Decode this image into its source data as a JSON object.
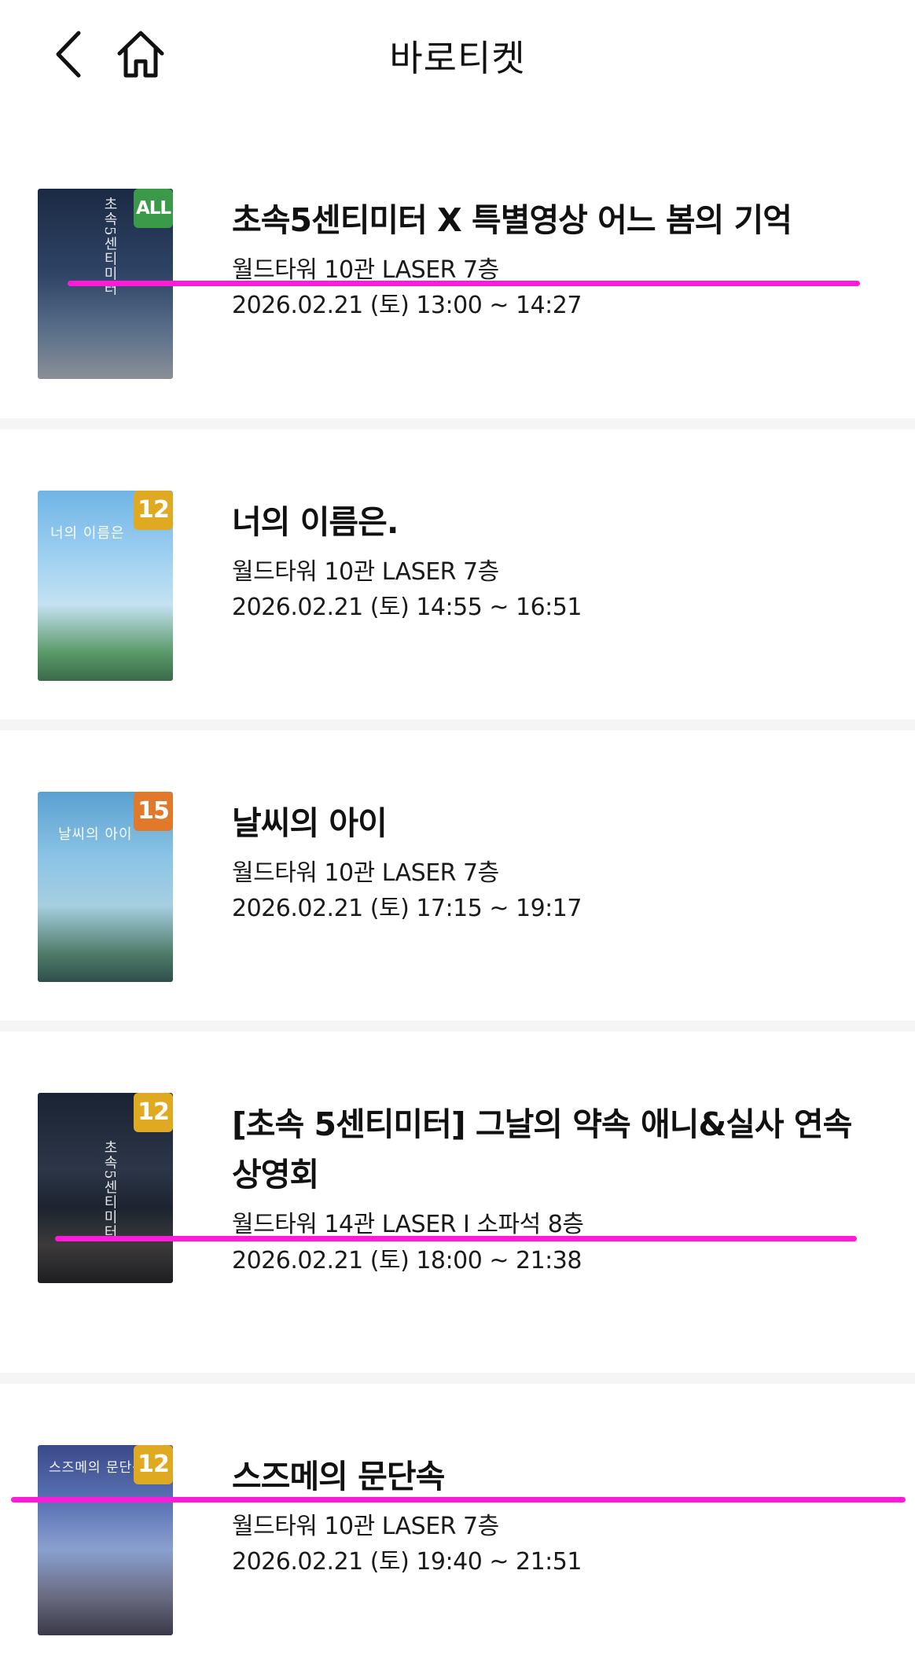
{
  "header": {
    "title": "바로티켓",
    "back_icon": "chevron-left-icon",
    "home_icon": "home-icon"
  },
  "movies": [
    {
      "title": "초속5센티미터 X 특별영상 어느 봄의 기억",
      "theater": "월드타워 10관 LASER 7층",
      "datetime": "2026.02.21 (토) 13:00 ~ 14:27",
      "rating": "ALL",
      "rating_color": "#3a9a4a",
      "poster_text": "초속5센티미터"
    },
    {
      "title": "너의 이름은.",
      "theater": "월드타워 10관 LASER 7층",
      "datetime": "2026.02.21 (토) 14:55 ~ 16:51",
      "rating": "12",
      "rating_color": "#e0a922",
      "poster_text": "너의 이름은"
    },
    {
      "title": "날씨의 아이",
      "theater": "월드타워 10관 LASER 7층",
      "datetime": "2026.02.21 (토) 17:15 ~ 19:17",
      "rating": "15",
      "rating_color": "#e07a2a",
      "poster_text": "날씨의 아이"
    },
    {
      "title": "[초속 5센티미터] 그날의 약속 애니&실사 연속 상영회",
      "theater": "월드타워 14관 LASER I 소파석 8층",
      "datetime": "2026.02.21 (토) 18:00 ~ 21:38",
      "rating": "12",
      "rating_color": "#e0a922",
      "poster_text": "초속5센티미터"
    },
    {
      "title": "스즈메의 문단속",
      "theater": "월드타워 10관 LASER 7층",
      "datetime": "2026.02.21 (토) 19:40 ~ 21:51",
      "rating": "12",
      "rating_color": "#e0a922",
      "poster_text": "스즈메의 문단속"
    }
  ],
  "annotation_color": "#ff19d8"
}
